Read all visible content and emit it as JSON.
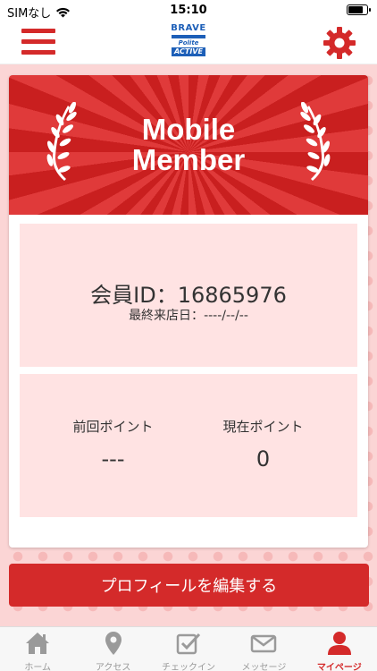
{
  "status_bar": {
    "carrier": "SIMなし",
    "time": "15:10",
    "wifi_icon": "wifi-icon",
    "battery_icon": "battery-icon"
  },
  "header": {
    "menu_icon": "hamburger-menu-icon",
    "logo": {
      "line1": "BRAVE",
      "line2": "Polite",
      "line3": "ACTIVE"
    },
    "settings_icon": "gear-icon"
  },
  "card": {
    "banner_title_line1": "Mobile",
    "banner_title_line2": "Member",
    "member_id_label": "会員ID：",
    "member_id": "16865976",
    "last_visit_label": "最終来店日：",
    "last_visit_value": "----/--/--",
    "previous_points_label": "前回ポイント",
    "previous_points_value": "---",
    "current_points_label": "現在ポイント",
    "current_points_value": "0"
  },
  "profile_button_label": "プロフィールを編集する",
  "tabs": [
    {
      "label": "ホーム",
      "icon": "home-icon",
      "active": false
    },
    {
      "label": "アクセス",
      "icon": "map-pin-icon",
      "active": false
    },
    {
      "label": "チェックイン",
      "icon": "checkin-icon",
      "active": false
    },
    {
      "label": "メッセージ",
      "icon": "mail-icon",
      "active": false
    },
    {
      "label": "マイページ",
      "icon": "user-icon",
      "active": true
    }
  ],
  "colors": {
    "accent": "#d42a2a",
    "background_pink": "#fbd5d5",
    "panel_pink": "#ffe3e3",
    "logo_blue": "#1d5fb8",
    "inactive_tab": "#999999"
  }
}
